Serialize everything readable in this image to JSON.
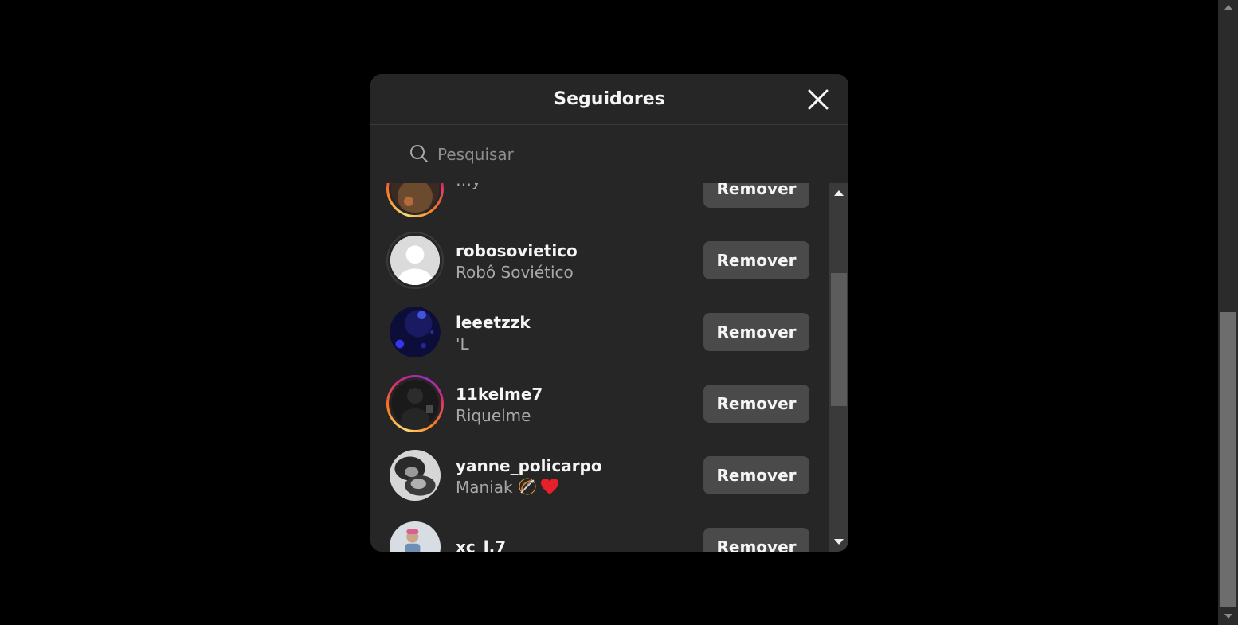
{
  "dialog": {
    "title": "Seguidores",
    "search_placeholder": "Pesquisar"
  },
  "followers": [
    {
      "username": "",
      "fullname": "…y",
      "remove_label": "Remover",
      "ring": true
    },
    {
      "username": "robosovietico",
      "fullname": "Robô Soviético",
      "remove_label": "Remover",
      "ring": false
    },
    {
      "username": "leeetzzk",
      "fullname": "'L",
      "remove_label": "Remover",
      "ring": false
    },
    {
      "username": "11kelme7",
      "fullname": "Riquelme",
      "remove_label": "Remover",
      "ring": true
    },
    {
      "username": "yanne_policarpo",
      "fullname": "Maniak",
      "fullname_emojis": [
        "bow-and-arrow-icon",
        "heart-icon"
      ],
      "remove_label": "Remover",
      "ring": false
    },
    {
      "username": "xc_l.7",
      "fullname": "",
      "remove_label": "Remover",
      "ring": false
    }
  ],
  "colors": {
    "background": "#000000",
    "dialog_bg": "#262626",
    "button_bg": "#4a4a4a",
    "text_primary": "#f5f5f5",
    "text_secondary": "#a8a8a8"
  }
}
